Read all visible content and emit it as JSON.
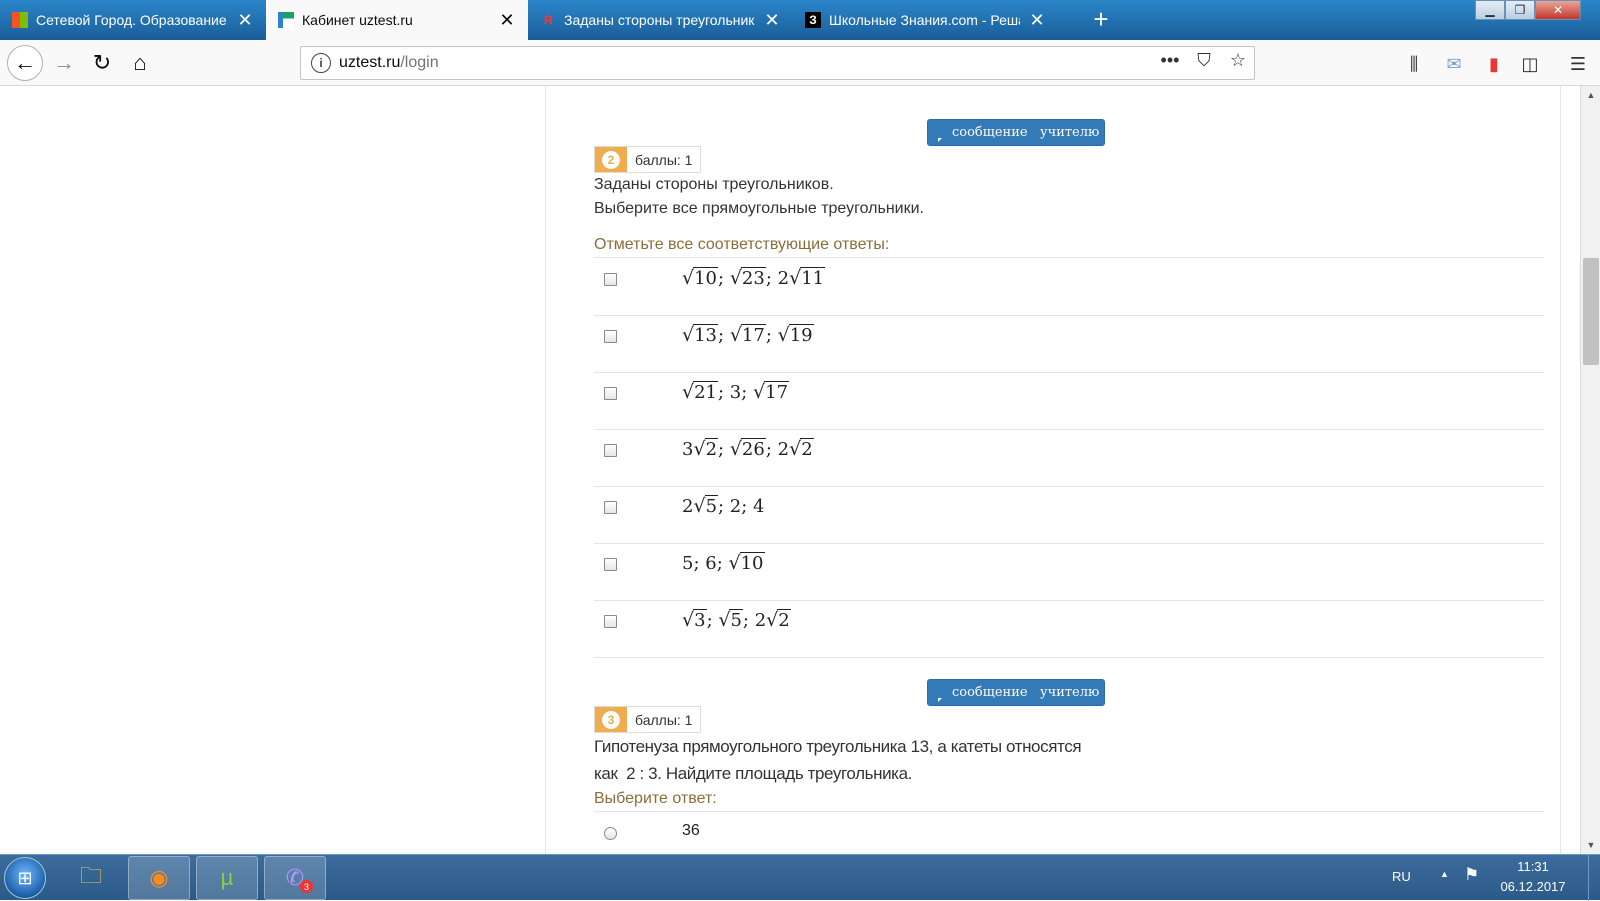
{
  "tabs": [
    {
      "title": "Сетевой Город. Образование. /",
      "icon": "windows-flag-icon"
    },
    {
      "title": "Кабинет uztest.ru",
      "icon": "uztest-icon",
      "active": true
    },
    {
      "title": "Заданы стороны треугольнико",
      "icon": "yandex-icon",
      "glyph": "Я"
    },
    {
      "title": "Школьные Знания.com - Решае",
      "icon": "znanija-icon",
      "glyph": "З"
    }
  ],
  "nav": {
    "url_host": "uztest.ru",
    "url_path": "/login",
    "more": "•••"
  },
  "questions": [
    {
      "message_button": "сообщение   учителю",
      "number": "2",
      "points": "баллы: 1",
      "text_line1": "Заданы стороны треугольников.",
      "text_line2": "Выберите все прямоугольные треугольники.",
      "hint": "Отметьте все соответствующие ответы:"
    },
    {
      "message_button": "сообщение   учителю",
      "number": "3",
      "points": "баллы: 1",
      "text_line1": "Гипотенуза прямоугольного треугольника 13, а катеты относятся",
      "text_line2": "как  2 : 3. Найдите площадь треугольника.",
      "hint": "Выберите ответ:"
    }
  ],
  "options_q2": [
    [
      {
        "r": "10"
      },
      "; ",
      {
        "r": "23"
      },
      "; 2",
      {
        "r": "11"
      }
    ],
    [
      {
        "r": "13"
      },
      "; ",
      {
        "r": "17"
      },
      "; ",
      {
        "r": "19"
      }
    ],
    [
      {
        "r": "21"
      },
      "; 3; ",
      {
        "r": "17"
      }
    ],
    [
      "3",
      {
        "r": "2"
      },
      "; ",
      {
        "r": "26"
      },
      "; 2",
      {
        "r": "2"
      }
    ],
    [
      "2",
      {
        "r": "5"
      },
      "; 2; 4"
    ],
    [
      "5; 6; ",
      {
        "r": "10"
      }
    ],
    [
      {
        "r": "3"
      },
      "; ",
      {
        "r": "5"
      },
      "; 2",
      {
        "r": "2"
      }
    ]
  ],
  "option_q3_first": "36",
  "taskbar": {
    "viber_badge": "3",
    "lang": "RU",
    "time": "11:31",
    "date": "06.12.2017"
  }
}
